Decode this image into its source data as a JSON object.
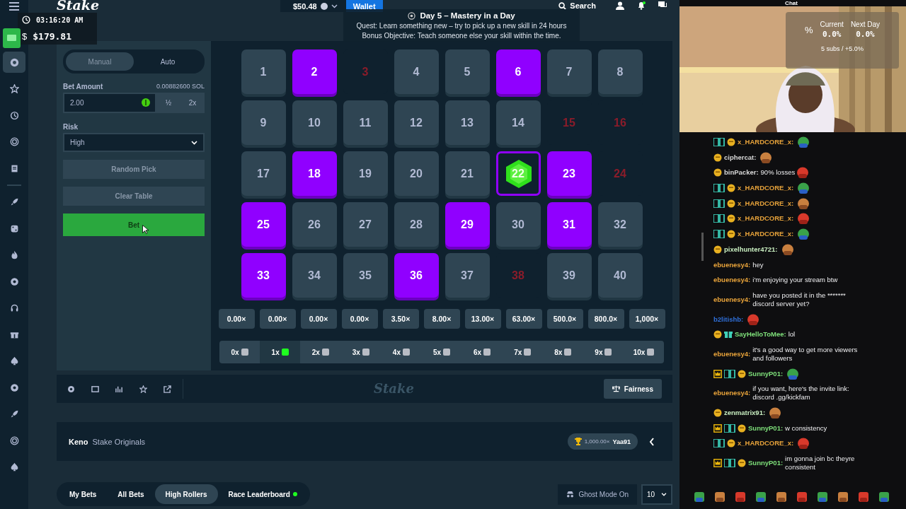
{
  "topbar": {
    "clock": "03:16:20 AM",
    "currency": "$",
    "balance": "$179.81",
    "logo": "Stake",
    "wallet_amount": "$50.48",
    "wallet_button": "Wallet",
    "search": "Search"
  },
  "quest": {
    "title": "Day 5 – Mastery in a Day",
    "quest": "Quest: Learn something new – try to pick up a new skill in 24 hours",
    "bonus": "Bonus Objective: Teach someone else your skill within the time."
  },
  "sidebar": {
    "items": [
      {
        "selected": true
      },
      {
        "selected": false
      },
      {
        "selected": false
      },
      {
        "selected": false
      },
      {
        "selected": false
      },
      {
        "selected": false
      },
      {
        "selected": false
      },
      {
        "selected": false
      },
      {
        "selected": false
      },
      {
        "selected": false
      },
      {
        "selected": false
      },
      {
        "selected": false
      },
      {
        "selected": false
      },
      {
        "selected": false
      },
      {
        "selected": false
      },
      {
        "selected": false
      }
    ]
  },
  "bet_panel": {
    "tabs": [
      {
        "label": "Manual",
        "selected": true
      },
      {
        "label": "Auto",
        "selected": false
      }
    ],
    "amount_label": "Bet Amount",
    "amount_crypto": "0.00882600 SOL",
    "amount": "2.00",
    "half": "½",
    "double": "2x",
    "risk_label": "Risk",
    "risk": "High",
    "random_pick": "Random Pick",
    "clear_table": "Clear Table",
    "bet_button": "Bet"
  },
  "board": {
    "tiles": [
      {
        "number": "1",
        "kind": "plain"
      },
      {
        "number": "2",
        "kind": "picked"
      },
      {
        "number": "3",
        "kind": "miss"
      },
      {
        "number": "4",
        "kind": "plain"
      },
      {
        "number": "5",
        "kind": "plain"
      },
      {
        "number": "6",
        "kind": "picked"
      },
      {
        "number": "7",
        "kind": "plain"
      },
      {
        "number": "8",
        "kind": "plain"
      },
      {
        "number": "9",
        "kind": "plain"
      },
      {
        "number": "10",
        "kind": "plain"
      },
      {
        "number": "11",
        "kind": "plain"
      },
      {
        "number": "12",
        "kind": "plain"
      },
      {
        "number": "13",
        "kind": "plain"
      },
      {
        "number": "14",
        "kind": "plain"
      },
      {
        "number": "15",
        "kind": "miss"
      },
      {
        "number": "16",
        "kind": "miss"
      },
      {
        "number": "17",
        "kind": "plain"
      },
      {
        "number": "18",
        "kind": "picked"
      },
      {
        "number": "19",
        "kind": "plain"
      },
      {
        "number": "20",
        "kind": "plain"
      },
      {
        "number": "21",
        "kind": "plain"
      },
      {
        "number": "22",
        "kind": "hit"
      },
      {
        "number": "23",
        "kind": "picked"
      },
      {
        "number": "24",
        "kind": "miss"
      },
      {
        "number": "25",
        "kind": "picked"
      },
      {
        "number": "26",
        "kind": "plain"
      },
      {
        "number": "27",
        "kind": "plain"
      },
      {
        "number": "28",
        "kind": "plain"
      },
      {
        "number": "29",
        "kind": "picked"
      },
      {
        "number": "30",
        "kind": "plain"
      },
      {
        "number": "31",
        "kind": "picked"
      },
      {
        "number": "32",
        "kind": "plain"
      },
      {
        "number": "33",
        "kind": "picked"
      },
      {
        "number": "34",
        "kind": "plain"
      },
      {
        "number": "35",
        "kind": "plain"
      },
      {
        "number": "36",
        "kind": "picked"
      },
      {
        "number": "37",
        "kind": "plain"
      },
      {
        "number": "38",
        "kind": "miss"
      },
      {
        "number": "39",
        "kind": "plain"
      },
      {
        "number": "40",
        "kind": "plain"
      }
    ]
  },
  "payouts": [
    "0.00×",
    "0.00×",
    "0.00×",
    "0.00×",
    "3.50×",
    "8.00×",
    "13.00×",
    "63.00×",
    "500.0×",
    "800.0×",
    "1,000×"
  ],
  "hits": [
    {
      "label": "0x",
      "selected": false
    },
    {
      "label": "1x",
      "selected": true
    },
    {
      "label": "2x",
      "selected": false
    },
    {
      "label": "3x",
      "selected": false
    },
    {
      "label": "4x",
      "selected": false
    },
    {
      "label": "5x",
      "selected": false
    },
    {
      "label": "6x",
      "selected": false
    },
    {
      "label": "7x",
      "selected": false
    },
    {
      "label": "8x",
      "selected": false
    },
    {
      "label": "9x",
      "selected": false
    },
    {
      "label": "10x",
      "selected": false
    }
  ],
  "toolbar": {
    "watermark": "Stake",
    "fairness": "Fairness"
  },
  "game_info": {
    "title": "Keno",
    "subtitle": "Stake Originals",
    "record_multiplier": "1,000.00×",
    "record_user": "Yaa91"
  },
  "bet_tabs": [
    {
      "label": "My Bets",
      "selected": false,
      "live": false
    },
    {
      "label": "All Bets",
      "selected": false,
      "live": false
    },
    {
      "label": "High Rollers",
      "selected": true,
      "live": false
    },
    {
      "label": "Race Leaderboard",
      "selected": false,
      "live": true
    }
  ],
  "ghost_mode": "Ghost Mode On",
  "page_size": "10",
  "stream": {
    "chat_header": "Chat",
    "stats": {
      "symbol": "%",
      "current_label": "Current",
      "current": "0.0%",
      "next_label": "Next Day",
      "next": "0.0%",
      "subs": "5 subs / +5.0%"
    }
  },
  "chat": [
    {
      "crown": false,
      "subscriber": true,
      "round_badge": true,
      "gift": false,
      "user": "x_HARDCORE_x:",
      "color": "#e8a33a",
      "emote": true
    },
    {
      "crown": false,
      "subscriber": false,
      "round_badge": true,
      "gift": false,
      "user": "ciphercat:",
      "color": "#d8d8d8",
      "emote": true
    },
    {
      "crown": false,
      "subscriber": false,
      "round_badge": true,
      "gift": false,
      "user": "binPacker:",
      "color": "#d8d8d8",
      "text": "90% losses",
      "emote": true
    },
    {
      "crown": false,
      "subscriber": true,
      "round_badge": true,
      "gift": false,
      "user": "x_HARDCORE_x:",
      "color": "#e8a33a",
      "emote": true
    },
    {
      "crown": false,
      "subscriber": true,
      "round_badge": true,
      "gift": false,
      "user": "x_HARDCORE_x:",
      "color": "#e8a33a",
      "emote": true
    },
    {
      "crown": false,
      "subscriber": true,
      "round_badge": true,
      "gift": false,
      "user": "x_HARDCORE_x:",
      "color": "#e8a33a",
      "emote": true
    },
    {
      "crown": false,
      "subscriber": true,
      "round_badge": true,
      "gift": false,
      "user": "x_HARDCORE_x:",
      "color": "#e8a33a",
      "emote": true
    },
    {
      "crown": false,
      "subscriber": false,
      "round_badge": true,
      "gift": false,
      "user": "pixelhunter4721:",
      "color": "#c8eec0",
      "emote": true
    },
    {
      "crown": false,
      "subscriber": false,
      "round_badge": false,
      "gift": false,
      "user": "ebuenesy4:",
      "color": "#e8a33a",
      "text": "hey",
      "emote": false
    },
    {
      "crown": false,
      "subscriber": false,
      "round_badge": false,
      "gift": false,
      "user": "ebuenesy4:",
      "color": "#e8a33a",
      "text": "i'm enjoying your stream btw",
      "emote": false
    },
    {
      "crown": false,
      "subscriber": false,
      "round_badge": false,
      "gift": false,
      "user": "ebuenesy4:",
      "color": "#e8a33a",
      "text": "have you posted it in the ******* discord server yet?",
      "emote": false
    },
    {
      "crown": false,
      "subscriber": false,
      "round_badge": false,
      "gift": false,
      "user": "b2litishb:",
      "color": "#2f6fd8",
      "emote": true
    },
    {
      "crown": false,
      "subscriber": false,
      "round_badge": true,
      "gift": true,
      "user": "SayHelloToMee:",
      "color": "#7ee07a",
      "text": "lol",
      "emote": false
    },
    {
      "crown": false,
      "subscriber": false,
      "round_badge": false,
      "gift": false,
      "user": "ebuenesy4:",
      "color": "#e8a33a",
      "text": "it's a good way to get more viewers and followers",
      "emote": false
    },
    {
      "crown": true,
      "subscriber": true,
      "round_badge": true,
      "gift": false,
      "user": "SunnyP01:",
      "color": "#7ee07a",
      "emote": true
    },
    {
      "crown": false,
      "subscriber": false,
      "round_badge": false,
      "gift": false,
      "user": "ebuenesy4:",
      "color": "#e8a33a",
      "text": "if you want, here's the invite link: discord .gg/kickfam",
      "emote": false
    },
    {
      "crown": false,
      "subscriber": false,
      "round_badge": true,
      "gift": false,
      "user": "zenmatrix91:",
      "color": "#c8eec0",
      "emote": true
    },
    {
      "crown": true,
      "subscriber": true,
      "round_badge": true,
      "gift": false,
      "user": "SunnyP01:",
      "color": "#7ee07a",
      "text": "w consistency",
      "emote": false
    },
    {
      "crown": false,
      "subscriber": true,
      "round_badge": true,
      "gift": false,
      "user": "x_HARDCORE_x:",
      "color": "#e8a33a",
      "emote": true
    },
    {
      "crown": true,
      "subscriber": true,
      "round_badge": true,
      "gift": false,
      "user": "SunnyP01:",
      "color": "#7ee07a",
      "text": "im gonna join bc theyre consistent",
      "emote": false
    }
  ]
}
